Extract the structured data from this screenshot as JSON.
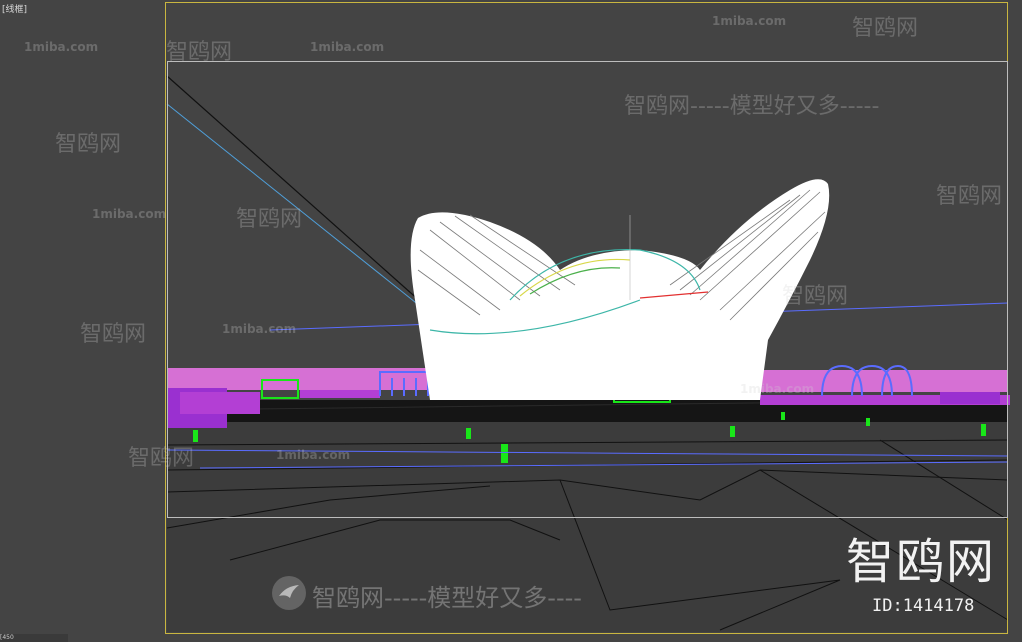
{
  "viewport": {
    "label": "[线框]"
  },
  "watermarks": {
    "repeated_domain": "1miba.com",
    "repeated_brand": "智鸥网",
    "slogan_line": "智鸥网-----模型好又多-----",
    "bottom_slogan": "智鸥网-----模型好又多----"
  },
  "brand": {
    "logo_text": "智鸥网",
    "id_text": "ID:1414178"
  },
  "status": {
    "readout": "[450"
  },
  "colors": {
    "viewport_bg": "#444444",
    "active_frame": "#c9b640",
    "wire_white": "#ffffff",
    "wire_magenta": "#e27be0",
    "wire_purple": "#9a30d0",
    "wire_green": "#19e619",
    "wire_blue": "#5a6cff"
  }
}
